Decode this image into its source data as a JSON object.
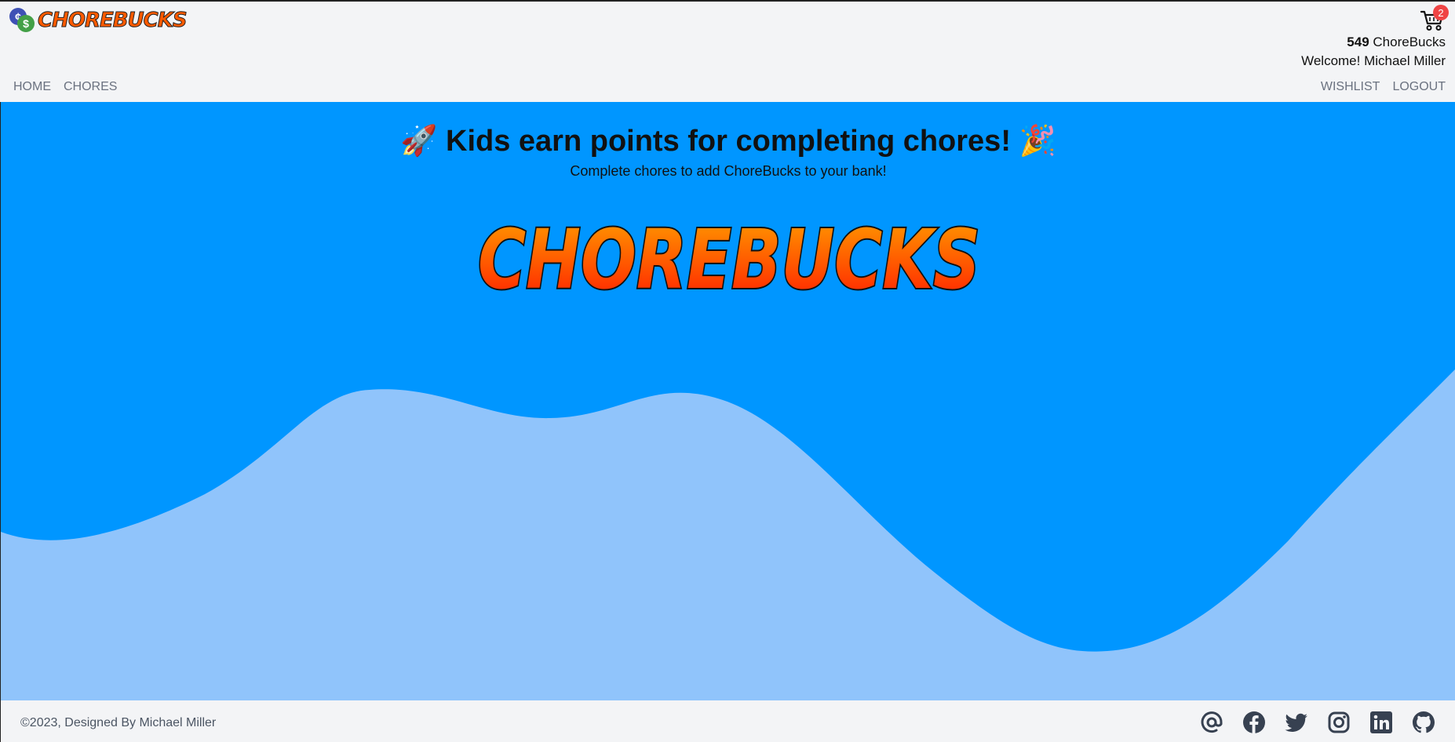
{
  "header": {
    "logo_text": "CHOREBUCKS",
    "cart_count": "2",
    "bucks_amount": "549",
    "bucks_unit": "ChoreBucks",
    "welcome": "Welcome! Michael Miller",
    "nav_left": [
      "HOME",
      "CHORES"
    ],
    "nav_right": [
      "WISHLIST",
      "LOGOUT"
    ]
  },
  "hero": {
    "title": "🚀 Kids earn points for completing chores! 🎉",
    "subtitle": "Complete chores to add ChoreBucks to your bank!",
    "logo_text": "CHOREBUCKS",
    "bg_color": "#0096ff",
    "wave_color": "#90c4fb"
  },
  "footer": {
    "copyright": "©2023, Designed By Michael Miller",
    "socials": [
      "email-icon",
      "facebook-icon",
      "twitter-icon",
      "instagram-icon",
      "linkedin-icon",
      "github-icon"
    ]
  }
}
